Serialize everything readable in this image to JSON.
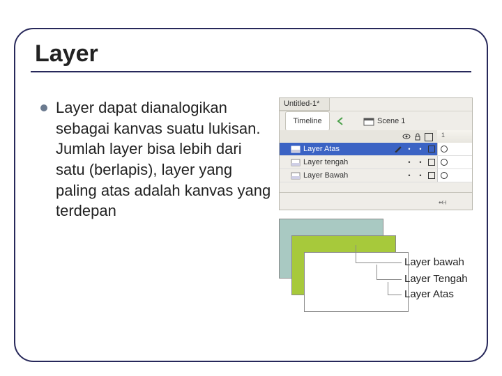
{
  "title": "Layer",
  "body": "Layer dapat dianalogikan sebagai kanvas suatu lukisan. Jumlah layer bisa lebih dari satu (berlapis), layer yang paling atas adalah kanvas yang terdepan",
  "panel": {
    "doc_tab": "Untitled-1*",
    "timeline_label": "Timeline",
    "scene": "Scene 1",
    "frame_marker": "1",
    "layers": [
      {
        "name": "Layer Atas",
        "selected": true
      },
      {
        "name": "Layer tengah",
        "selected": false
      },
      {
        "name": "Layer Bawah",
        "selected": false
      }
    ]
  },
  "stack_labels": [
    "Layer bawah",
    "Layer Tengah",
    "Layer Atas"
  ],
  "stack_colors": {
    "bottom": "#a9c9c2",
    "middle": "#a7c93b",
    "top": "#ffffff"
  }
}
